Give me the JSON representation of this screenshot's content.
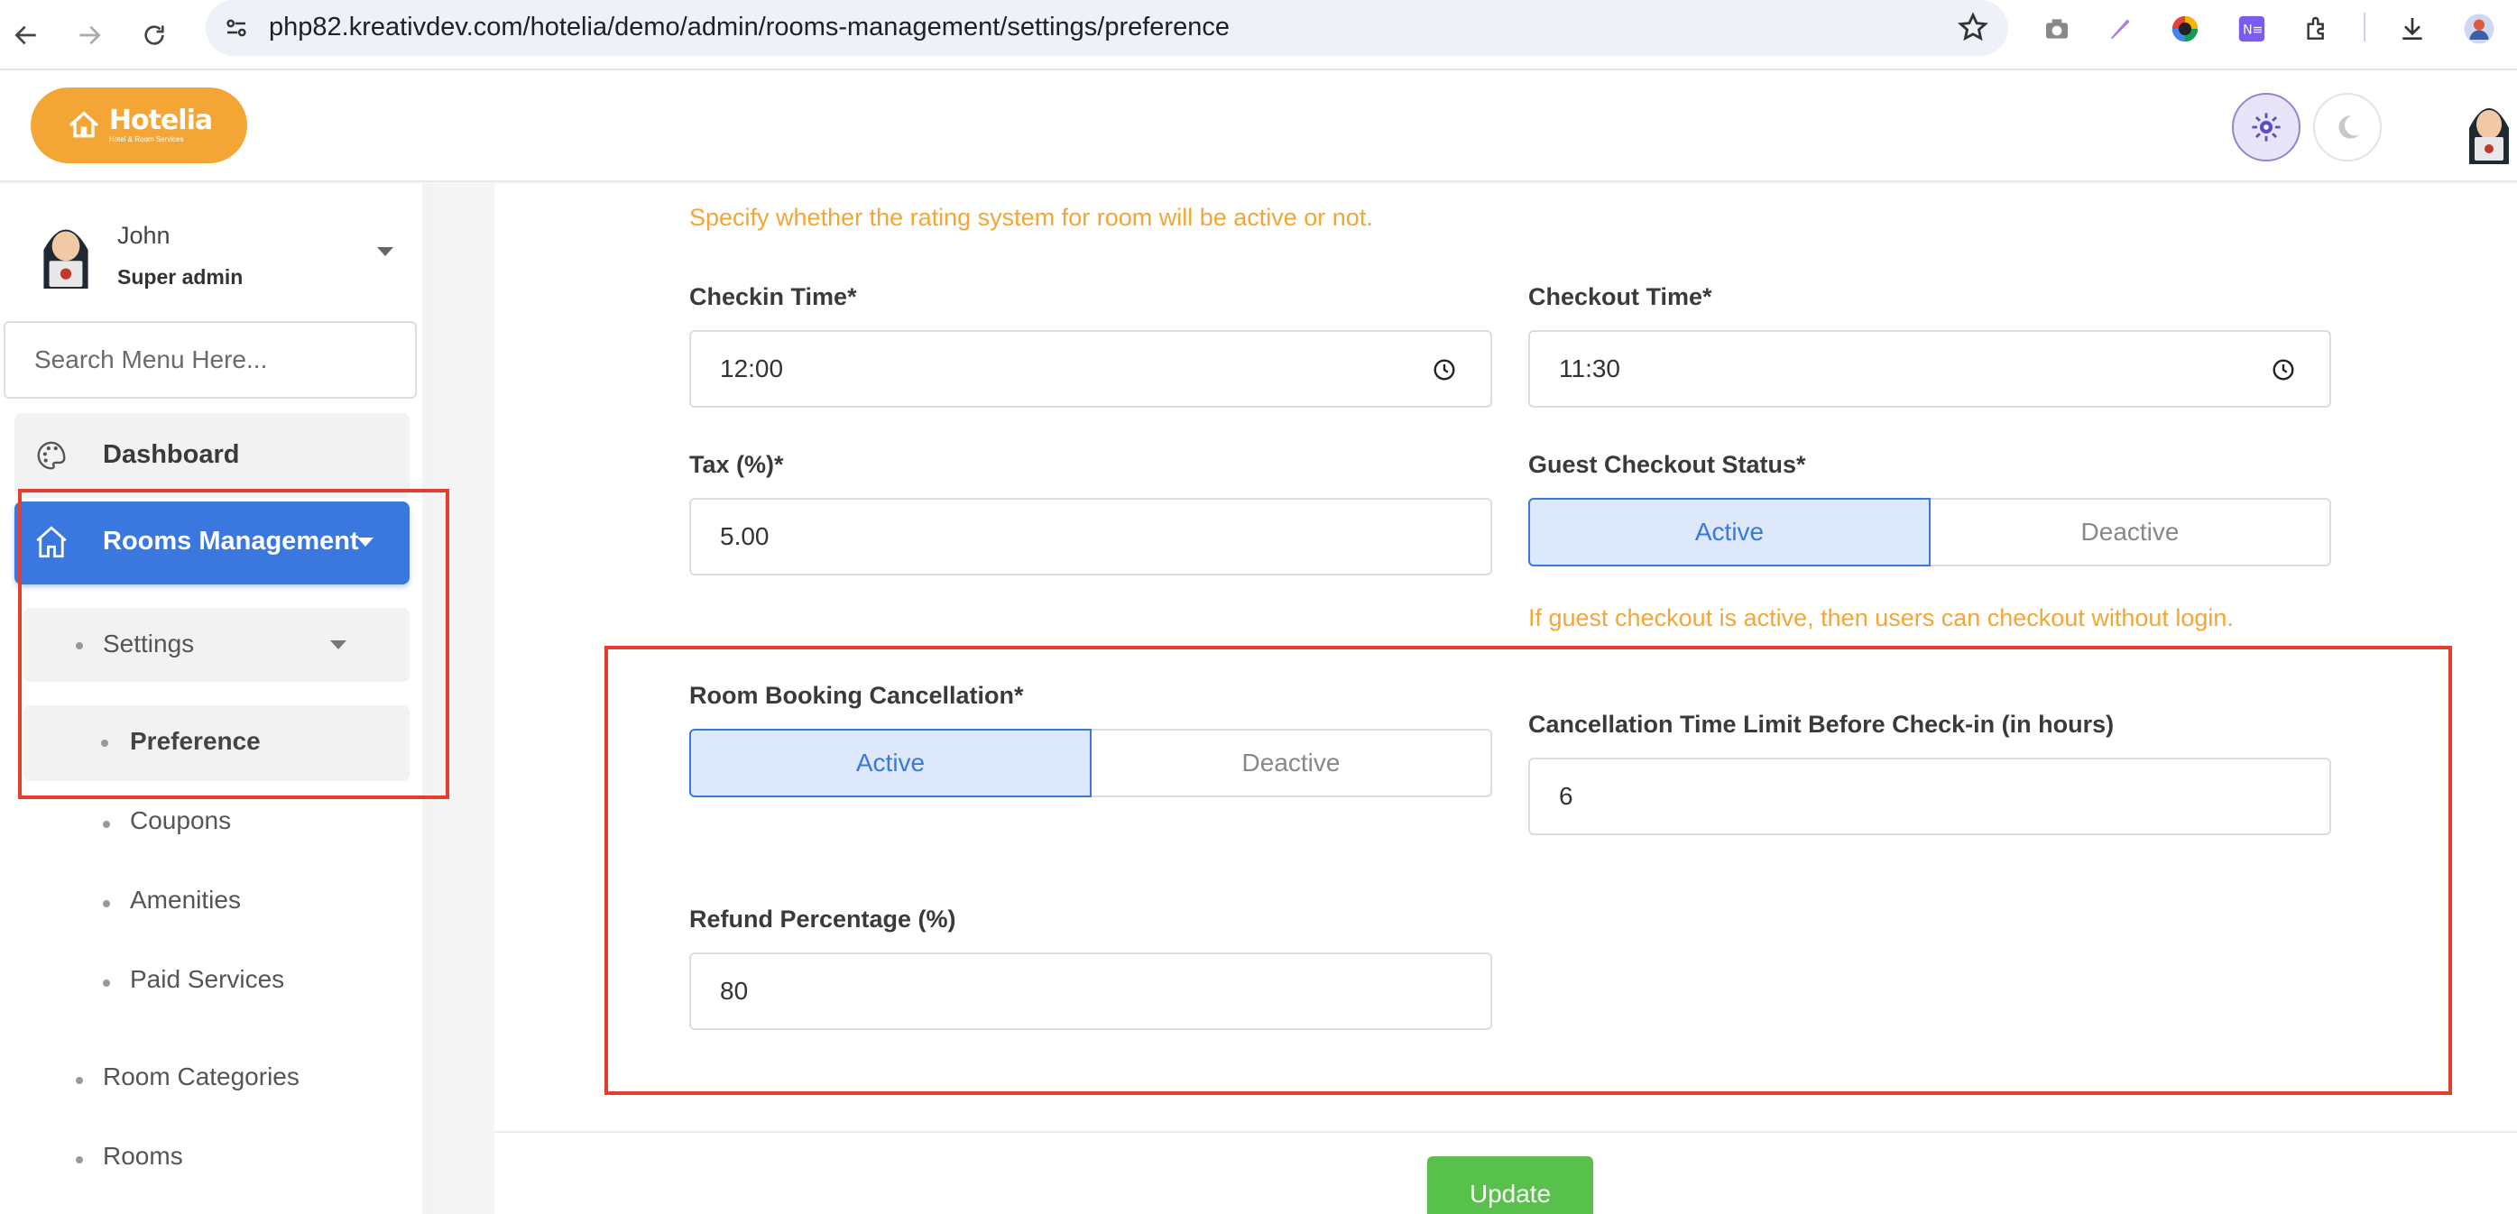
{
  "browser": {
    "url": "php82.kreativdev.com/hotelia/demo/admin/rooms-management/settings/preference"
  },
  "header": {
    "logo_name": "Hotelia",
    "logo_sub": "Hotel & Room Services"
  },
  "user": {
    "name": "John",
    "role": "Super admin"
  },
  "sidebar": {
    "search_placeholder": "Search Menu Here...",
    "dashboard": "Dashboard",
    "rooms_management": "Rooms Management",
    "settings": "Settings",
    "preference": "Preference",
    "coupons": "Coupons",
    "amenities": "Amenities",
    "paid_services": "Paid Services",
    "room_categories": "Room Categories",
    "rooms": "Rooms"
  },
  "form": {
    "rating_hint": "Specify whether the rating system for room will be active or not.",
    "checkin_label": "Checkin Time*",
    "checkin_value": "12:00",
    "checkout_label": "Checkout Time*",
    "checkout_value": "11:30",
    "tax_label": "Tax (%)*",
    "tax_value": "5.00",
    "guest_checkout_label": "Guest Checkout Status*",
    "guest_active": "Active",
    "guest_deactive": "Deactive",
    "guest_hint": "If guest checkout is active, then users can checkout without login.",
    "cancellation_label": "Room Booking Cancellation*",
    "cancellation_active": "Active",
    "cancellation_deactive": "Deactive",
    "time_limit_label": "Cancellation Time Limit Before Check-in (in hours)",
    "time_limit_value": "6",
    "refund_label": "Refund Percentage (%)",
    "refund_value": "80",
    "update_button": "Update"
  },
  "colors": {
    "primary": "#3a78e0",
    "accent": "#f3a636",
    "success": "#58c14c",
    "highlight": "#e43f2e"
  }
}
